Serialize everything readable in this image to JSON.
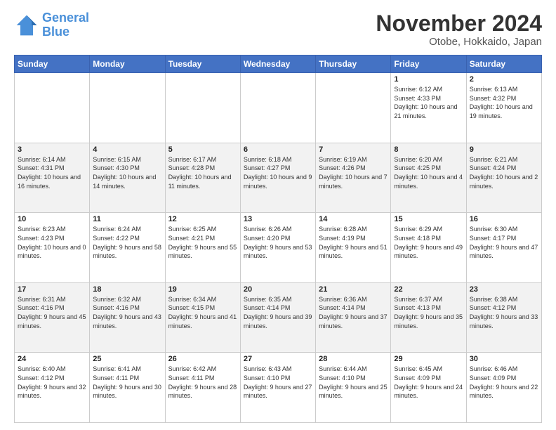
{
  "logo": {
    "line1": "General",
    "line2": "Blue"
  },
  "header": {
    "month": "November 2024",
    "location": "Otobe, Hokkaido, Japan"
  },
  "weekdays": [
    "Sunday",
    "Monday",
    "Tuesday",
    "Wednesday",
    "Thursday",
    "Friday",
    "Saturday"
  ],
  "weeks": [
    [
      {
        "day": "",
        "info": ""
      },
      {
        "day": "",
        "info": ""
      },
      {
        "day": "",
        "info": ""
      },
      {
        "day": "",
        "info": ""
      },
      {
        "day": "",
        "info": ""
      },
      {
        "day": "1",
        "info": "Sunrise: 6:12 AM\nSunset: 4:33 PM\nDaylight: 10 hours and 21 minutes."
      },
      {
        "day": "2",
        "info": "Sunrise: 6:13 AM\nSunset: 4:32 PM\nDaylight: 10 hours and 19 minutes."
      }
    ],
    [
      {
        "day": "3",
        "info": "Sunrise: 6:14 AM\nSunset: 4:31 PM\nDaylight: 10 hours and 16 minutes."
      },
      {
        "day": "4",
        "info": "Sunrise: 6:15 AM\nSunset: 4:30 PM\nDaylight: 10 hours and 14 minutes."
      },
      {
        "day": "5",
        "info": "Sunrise: 6:17 AM\nSunset: 4:28 PM\nDaylight: 10 hours and 11 minutes."
      },
      {
        "day": "6",
        "info": "Sunrise: 6:18 AM\nSunset: 4:27 PM\nDaylight: 10 hours and 9 minutes."
      },
      {
        "day": "7",
        "info": "Sunrise: 6:19 AM\nSunset: 4:26 PM\nDaylight: 10 hours and 7 minutes."
      },
      {
        "day": "8",
        "info": "Sunrise: 6:20 AM\nSunset: 4:25 PM\nDaylight: 10 hours and 4 minutes."
      },
      {
        "day": "9",
        "info": "Sunrise: 6:21 AM\nSunset: 4:24 PM\nDaylight: 10 hours and 2 minutes."
      }
    ],
    [
      {
        "day": "10",
        "info": "Sunrise: 6:23 AM\nSunset: 4:23 PM\nDaylight: 10 hours and 0 minutes."
      },
      {
        "day": "11",
        "info": "Sunrise: 6:24 AM\nSunset: 4:22 PM\nDaylight: 9 hours and 58 minutes."
      },
      {
        "day": "12",
        "info": "Sunrise: 6:25 AM\nSunset: 4:21 PM\nDaylight: 9 hours and 55 minutes."
      },
      {
        "day": "13",
        "info": "Sunrise: 6:26 AM\nSunset: 4:20 PM\nDaylight: 9 hours and 53 minutes."
      },
      {
        "day": "14",
        "info": "Sunrise: 6:28 AM\nSunset: 4:19 PM\nDaylight: 9 hours and 51 minutes."
      },
      {
        "day": "15",
        "info": "Sunrise: 6:29 AM\nSunset: 4:18 PM\nDaylight: 9 hours and 49 minutes."
      },
      {
        "day": "16",
        "info": "Sunrise: 6:30 AM\nSunset: 4:17 PM\nDaylight: 9 hours and 47 minutes."
      }
    ],
    [
      {
        "day": "17",
        "info": "Sunrise: 6:31 AM\nSunset: 4:16 PM\nDaylight: 9 hours and 45 minutes."
      },
      {
        "day": "18",
        "info": "Sunrise: 6:32 AM\nSunset: 4:16 PM\nDaylight: 9 hours and 43 minutes."
      },
      {
        "day": "19",
        "info": "Sunrise: 6:34 AM\nSunset: 4:15 PM\nDaylight: 9 hours and 41 minutes."
      },
      {
        "day": "20",
        "info": "Sunrise: 6:35 AM\nSunset: 4:14 PM\nDaylight: 9 hours and 39 minutes."
      },
      {
        "day": "21",
        "info": "Sunrise: 6:36 AM\nSunset: 4:14 PM\nDaylight: 9 hours and 37 minutes."
      },
      {
        "day": "22",
        "info": "Sunrise: 6:37 AM\nSunset: 4:13 PM\nDaylight: 9 hours and 35 minutes."
      },
      {
        "day": "23",
        "info": "Sunrise: 6:38 AM\nSunset: 4:12 PM\nDaylight: 9 hours and 33 minutes."
      }
    ],
    [
      {
        "day": "24",
        "info": "Sunrise: 6:40 AM\nSunset: 4:12 PM\nDaylight: 9 hours and 32 minutes."
      },
      {
        "day": "25",
        "info": "Sunrise: 6:41 AM\nSunset: 4:11 PM\nDaylight: 9 hours and 30 minutes."
      },
      {
        "day": "26",
        "info": "Sunrise: 6:42 AM\nSunset: 4:11 PM\nDaylight: 9 hours and 28 minutes."
      },
      {
        "day": "27",
        "info": "Sunrise: 6:43 AM\nSunset: 4:10 PM\nDaylight: 9 hours and 27 minutes."
      },
      {
        "day": "28",
        "info": "Sunrise: 6:44 AM\nSunset: 4:10 PM\nDaylight: 9 hours and 25 minutes."
      },
      {
        "day": "29",
        "info": "Sunrise: 6:45 AM\nSunset: 4:09 PM\nDaylight: 9 hours and 24 minutes."
      },
      {
        "day": "30",
        "info": "Sunrise: 6:46 AM\nSunset: 4:09 PM\nDaylight: 9 hours and 22 minutes."
      }
    ]
  ]
}
